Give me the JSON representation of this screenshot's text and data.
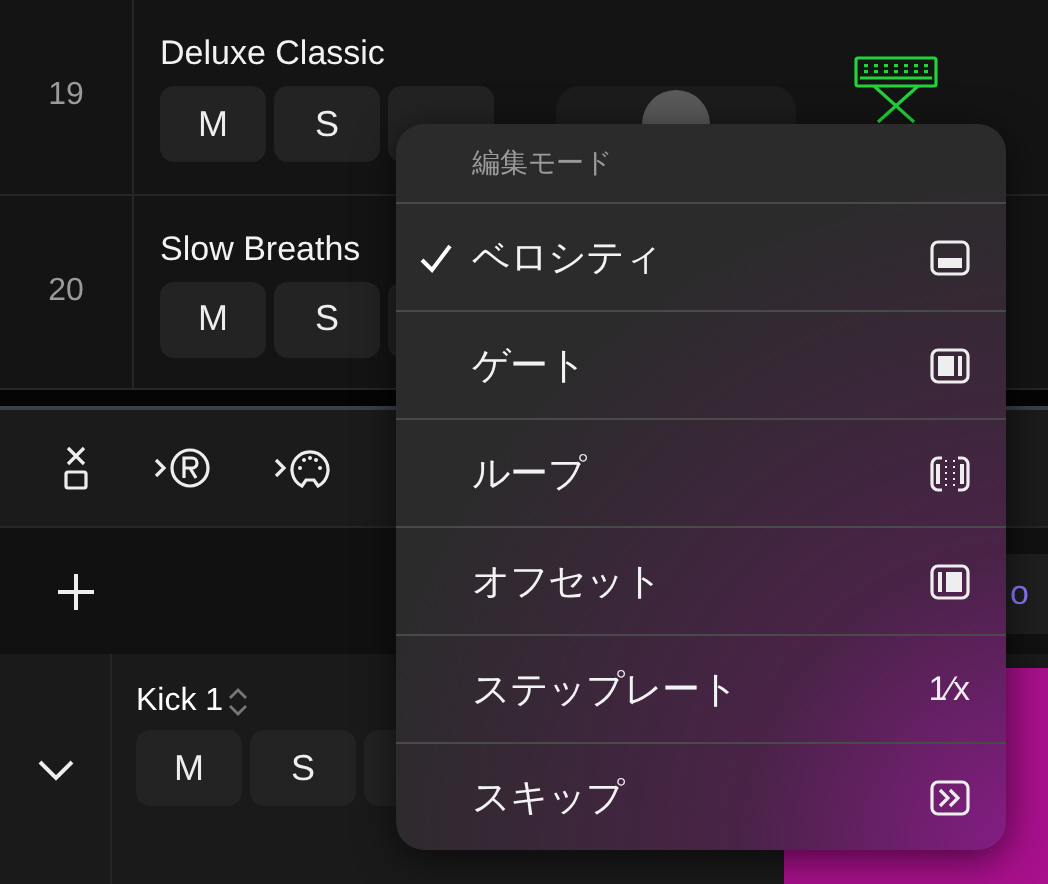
{
  "tracks": [
    {
      "number": "19",
      "name": "Deluxe Classic",
      "buttons": [
        "M",
        "S"
      ],
      "pan": {
        "level": 0.5
      }
    },
    {
      "number": "20",
      "name": "Slow Breaths",
      "buttons": [
        "M",
        "S"
      ]
    }
  ],
  "lower_panel": {
    "partial_label": "o",
    "track": {
      "name": "Kick 1",
      "buttons": [
        "M",
        "S"
      ],
      "expanded": true
    }
  },
  "menu": {
    "header": "編集モード",
    "items": [
      {
        "label": "ベロシティ",
        "selected": true,
        "kind": "velocity"
      },
      {
        "label": "ゲート",
        "selected": false,
        "kind": "gate"
      },
      {
        "label": "ループ",
        "selected": false,
        "kind": "loop"
      },
      {
        "label": "オフセット",
        "selected": false,
        "kind": "offset"
      },
      {
        "label": "ステップレート",
        "selected": false,
        "kind": "rate",
        "icon_text": "1⁄x"
      },
      {
        "label": "スキップ",
        "selected": false,
        "kind": "skip"
      }
    ]
  }
}
